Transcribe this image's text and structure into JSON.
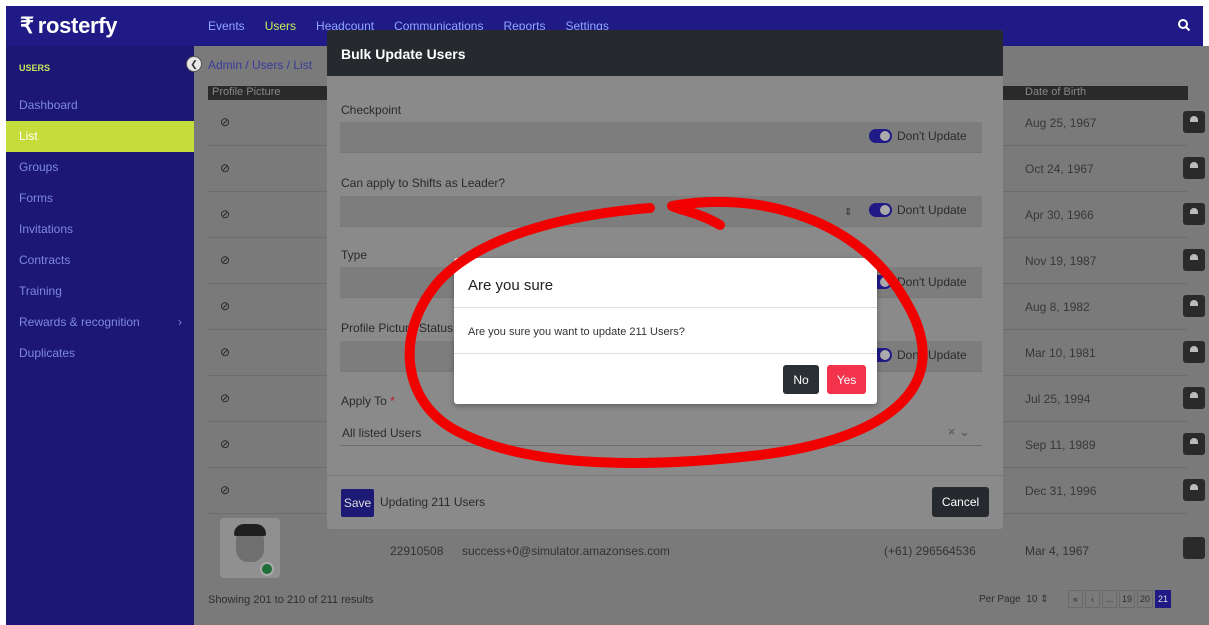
{
  "app": {
    "logo_text": "rosterfy"
  },
  "nav": {
    "items": [
      "Events",
      "Users",
      "Headcount",
      "Communications",
      "Reports",
      "Settings"
    ],
    "active": "Users"
  },
  "sidebar": {
    "header": "USERS",
    "items": [
      {
        "label": "Dashboard"
      },
      {
        "label": "List",
        "active": true
      },
      {
        "label": "Groups"
      },
      {
        "label": "Forms"
      },
      {
        "label": "Invitations"
      },
      {
        "label": "Contracts"
      },
      {
        "label": "Training"
      },
      {
        "label": "Rewards & recognition",
        "has_submenu": true
      },
      {
        "label": "Duplicates"
      }
    ]
  },
  "breadcrumb": "Admin  /  Users  /  List",
  "table": {
    "headers": {
      "profile_picture": "Profile Picture",
      "date_of_birth": "Date of Birth"
    },
    "rows": [
      {
        "dob": "Aug 25, 1967"
      },
      {
        "dob": "Oct 24, 1967"
      },
      {
        "dob": "Apr 30, 1966"
      },
      {
        "dob": "Nov 19, 1987"
      },
      {
        "dob": "Aug 8, 1982"
      },
      {
        "dob": "Mar 10, 1981"
      },
      {
        "dob": "Jul 25, 1994"
      },
      {
        "dob": "Sep 11, 1989"
      },
      {
        "dob": "Dec 31, 1996"
      }
    ],
    "last_row": {
      "id": "22910508",
      "email": "success+0@simulator.amazonses.com",
      "phone": "(+61) 296564536",
      "dob": "Mar 4, 1967"
    }
  },
  "footer": {
    "results": "Showing 201 to 210 of 211 results",
    "per_page_label": "Per Page",
    "per_page_value": "10",
    "pages": [
      "«",
      "‹",
      "...",
      "19",
      "20",
      "21"
    ],
    "current_page": "21"
  },
  "bulk_modal": {
    "title": "Bulk Update Users",
    "fields": [
      {
        "label": "Checkpoint",
        "toggle_label": "Don't Update"
      },
      {
        "label": "Can apply to Shifts as Leader?",
        "toggle_label": "Don't Update"
      },
      {
        "label": "Type",
        "toggle_label": "Don't Update"
      },
      {
        "label": "Profile Picture Status",
        "toggle_label": "Don't Update"
      }
    ],
    "apply_to_label": "Apply To",
    "required_mark": "*",
    "apply_to_value": "All listed Users",
    "save_label": "Save",
    "updating_text": "Updating 211 Users",
    "cancel_label": "Cancel"
  },
  "confirm": {
    "title": "Are you sure",
    "message": "Are you sure you want to update 211 Users?",
    "no_label": "No",
    "yes_label": "Yes"
  },
  "colors": {
    "brand": "#1f1a86",
    "accent": "#c5dd3a",
    "danger": "#f2334b",
    "annotation": "#f10000"
  }
}
